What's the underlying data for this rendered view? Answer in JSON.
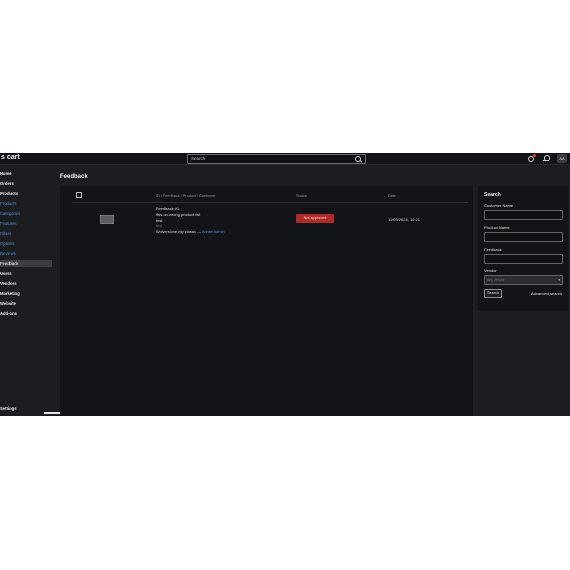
{
  "app": {
    "logo": "s cart"
  },
  "topbar": {
    "search_placeholder": "Search",
    "avatar_initials": "AA"
  },
  "sidebar": {
    "items": [
      {
        "label": "Home"
      },
      {
        "label": "Orders"
      },
      {
        "label": "Products"
      },
      {
        "label": "Products"
      },
      {
        "label": "Categories"
      },
      {
        "label": "Features"
      },
      {
        "label": "Filters"
      },
      {
        "label": "Options"
      },
      {
        "label": "Reviews"
      },
      {
        "label": "Feedback"
      },
      {
        "label": "Users"
      },
      {
        "label": "Vendors"
      },
      {
        "label": "Marketing"
      },
      {
        "label": "Website"
      },
      {
        "label": "Add-ons"
      },
      {
        "label": "Settings"
      }
    ]
  },
  "page": {
    "title": "Feedback"
  },
  "table": {
    "headers": {
      "ref": "ID / Feedback / Product / Customer",
      "status": "Status",
      "date": "Date"
    },
    "rows": [
      {
        "title": "Feedback #1",
        "line1": "this on wrong product list",
        "line2": "test",
        "line3": "test",
        "meta_prefix": "Wolverstone city classic — ",
        "author": "Adrian Admin",
        "status": "Not approved",
        "date": "11/03/2024, 10:21"
      }
    ]
  },
  "search_panel": {
    "title": "Search",
    "customer_label": "Customer Name",
    "product_label": "Product Name",
    "feedback_label": "Feedback",
    "vendor_label": "Vendor",
    "vendor_placeholder": "Any vendor",
    "search_button": "Search",
    "advanced_link": "Advanced search"
  },
  "colors": {
    "badge": "#b02a2a",
    "link": "#4d8fd6",
    "background": "#1b1d20"
  }
}
